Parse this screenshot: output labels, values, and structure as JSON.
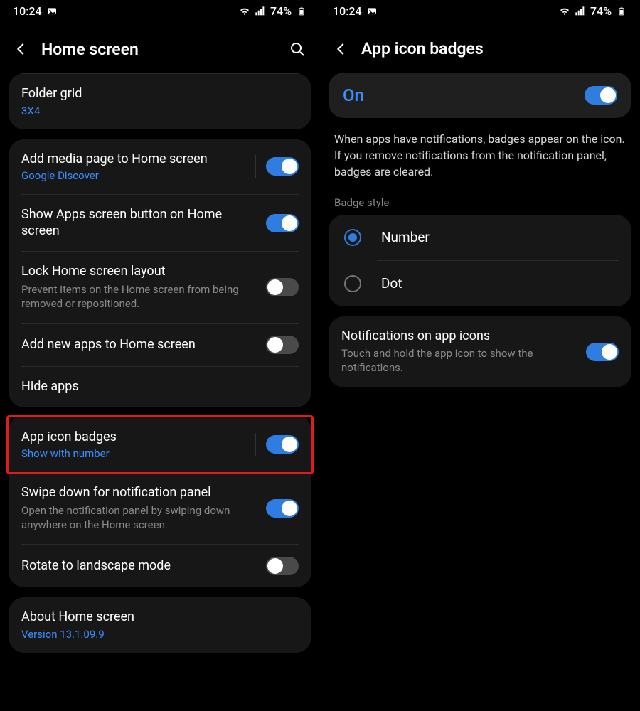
{
  "left": {
    "status": {
      "time": "10:24",
      "battery": "74%"
    },
    "title": "Home screen",
    "folder_grid": {
      "title": "Folder grid",
      "value": "3X4"
    },
    "media_page": {
      "title": "Add media page to Home screen",
      "sub": "Google Discover",
      "on": true
    },
    "apps_button": {
      "title": "Show Apps screen button on Home screen",
      "on": true
    },
    "lock_layout": {
      "title": "Lock Home screen layout",
      "sub": "Prevent items on the Home screen from being removed or repositioned.",
      "on": false
    },
    "add_new": {
      "title": "Add new apps to Home screen",
      "on": false
    },
    "hide_apps": {
      "title": "Hide apps"
    },
    "badges": {
      "title": "App icon badges",
      "sub": "Show with number",
      "on": true
    },
    "swipe_down": {
      "title": "Swipe down for notification panel",
      "sub": "Open the notification panel by swiping down anywhere on the Home screen.",
      "on": true
    },
    "rotate": {
      "title": "Rotate to landscape mode",
      "on": false
    },
    "about": {
      "title": "About Home screen",
      "sub": "Version 13.1.09.9"
    }
  },
  "right": {
    "status": {
      "time": "10:24",
      "battery": "74%"
    },
    "title": "App icon badges",
    "banner": {
      "label": "On",
      "on": true
    },
    "description": "When apps have notifications, badges appear on the icon. If you remove notifications from the notification panel, badges are cleared.",
    "section": "Badge style",
    "options": {
      "number": "Number",
      "dot": "Dot",
      "selected": "number"
    },
    "notif_icons": {
      "title": "Notifications on app icons",
      "sub": "Touch and hold the app icon to show the notifications.",
      "on": true
    }
  }
}
